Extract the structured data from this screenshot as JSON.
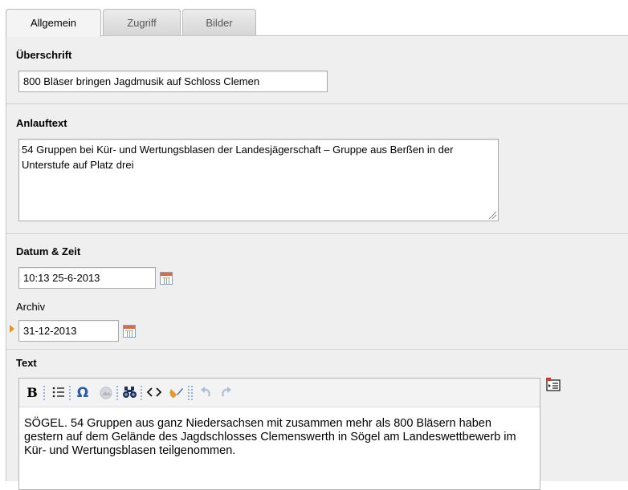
{
  "tabs": [
    {
      "label": "Allgemein",
      "active": true
    },
    {
      "label": "Zugriff",
      "active": false
    },
    {
      "label": "Bilder",
      "active": false
    }
  ],
  "headline": {
    "label": "Überschrift",
    "value": "800 Bläser bringen Jagdmusik auf Schloss Clemen"
  },
  "teaser": {
    "label": "Anlauftext",
    "value": "54 Gruppen bei Kür- und Wertungsblasen der Landesjägerschaft – Gruppe aus Berßen in der Unterstufe auf Platz drei"
  },
  "datetime": {
    "label": "Datum & Zeit",
    "value": "10:13 25-6-2013",
    "archive_label": "Archiv",
    "archive_value": "31-12-2013"
  },
  "text": {
    "label": "Text",
    "paragraph1": "SÖGEL. 54 Gruppen aus ganz Niedersachsen mit zusammen mehr als 800 Bläsern haben gestern auf dem Gelände des Jagdschlosses Clemenswerth in Sögel am Landeswettbewerb im Kür- und Wertungsblasen teilgenommen.",
    "paragraph2": ""
  },
  "toolbar_icons": [
    "bold-icon",
    "bulleted-list-icon",
    "omega-special-char-icon",
    "image-icon",
    "find-replace-icon",
    "html-source-icon",
    "clean-format-icon",
    "undo-icon",
    "redo-icon"
  ],
  "colors": {
    "panel_bg": "#efefef",
    "marker": "#e6961f",
    "toolbar_icon_blue": "#2b5ea8"
  }
}
